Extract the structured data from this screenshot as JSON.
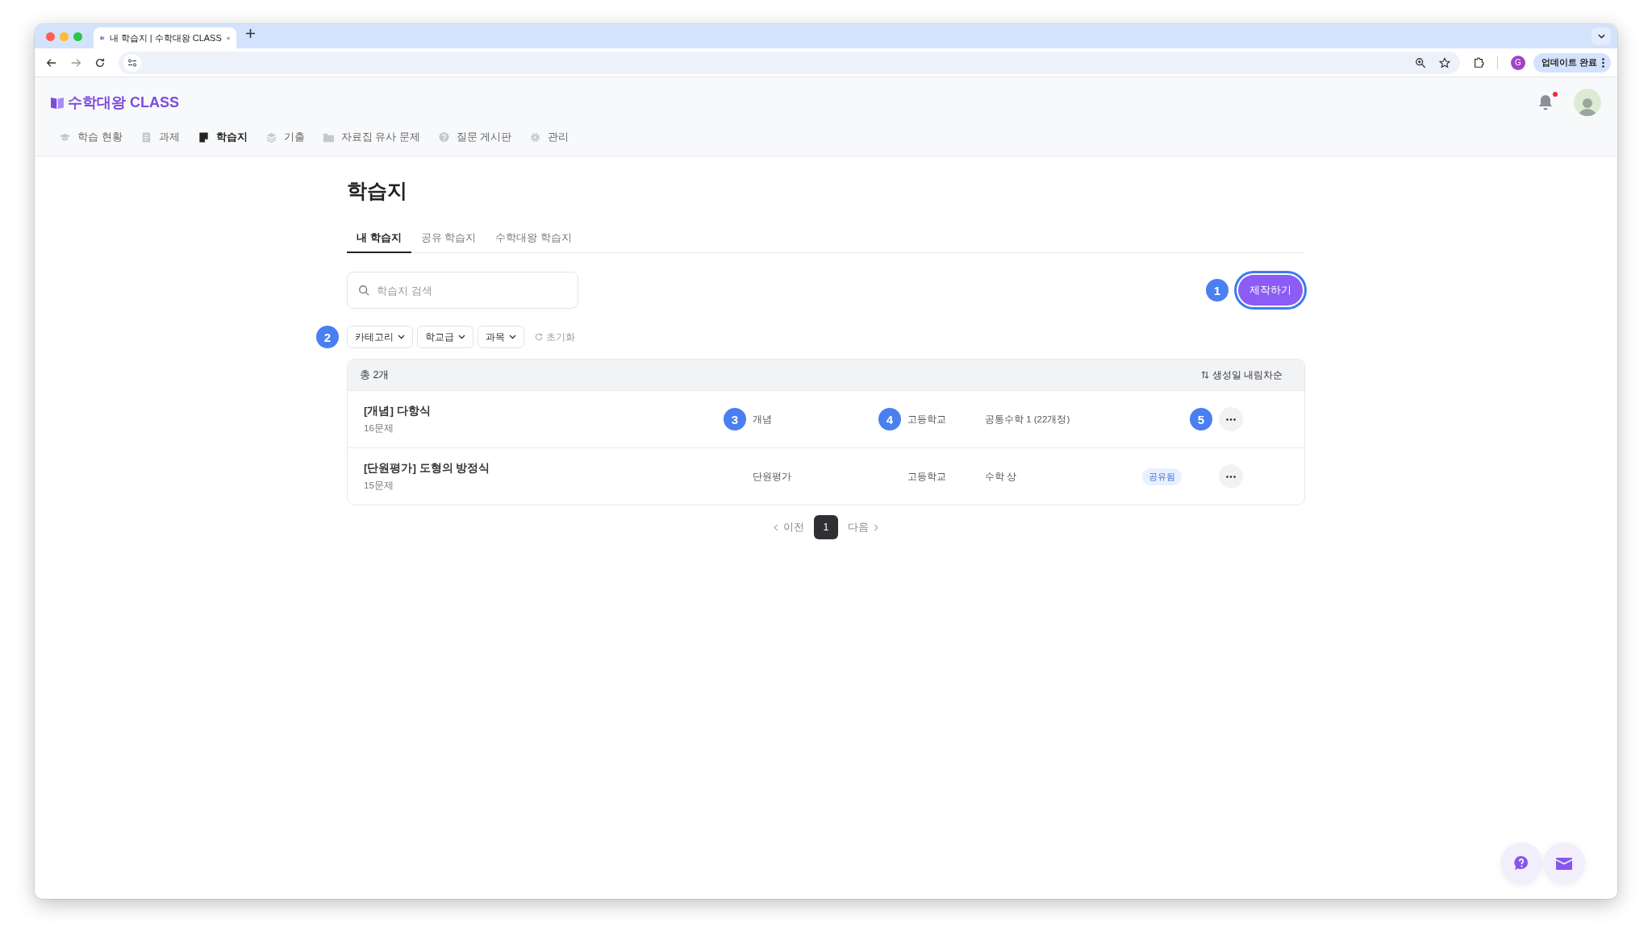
{
  "browser": {
    "tab_title": "내 학습지 | 수학대왕 CLASS",
    "profile_initial": "G",
    "update_button": "업데이트 완료"
  },
  "app": {
    "logo": "수학대왕 CLASS",
    "notification_unread": true,
    "nav": [
      {
        "label": "학습 현황",
        "selected": false
      },
      {
        "label": "과제",
        "selected": false
      },
      {
        "label": "학습지",
        "selected": true
      },
      {
        "label": "기출",
        "selected": false
      },
      {
        "label": "자료집 유사 문제",
        "selected": false
      },
      {
        "label": "질문 게시판",
        "selected": false
      },
      {
        "label": "관리",
        "selected": false
      }
    ]
  },
  "page": {
    "title": "학습지",
    "tabs": [
      {
        "label": "내 학습지",
        "selected": true
      },
      {
        "label": "공유 학습지",
        "selected": false
      },
      {
        "label": "수학대왕 학습지",
        "selected": false
      }
    ],
    "search": {
      "placeholder": "학습지 검색"
    },
    "create_button": "제작하기",
    "create_marker": "1",
    "filters_marker": "2",
    "filters": [
      "카테고리",
      "학교급",
      "과목"
    ],
    "reset": "초기화",
    "table": {
      "total": "총 2개",
      "sort": "생성일 내림차순",
      "shared_label": "공유됨",
      "rows": [
        {
          "title": "[개념] 다항식",
          "count": "16문제",
          "category": "개념",
          "school": "고등학교",
          "subject": "공통수학 1 (22개정)",
          "shared": false,
          "markers": {
            "category": "3",
            "school": "4",
            "actions": "5"
          }
        },
        {
          "title": "[단원평가] 도형의 방정식",
          "count": "15문제",
          "category": "단원평가",
          "school": "고등학교",
          "subject": "수학 상",
          "shared": true,
          "markers": {}
        }
      ]
    },
    "pagination": {
      "prev": "이전",
      "pages": [
        {
          "label": "1",
          "selected": true
        }
      ],
      "next": "다음"
    }
  }
}
